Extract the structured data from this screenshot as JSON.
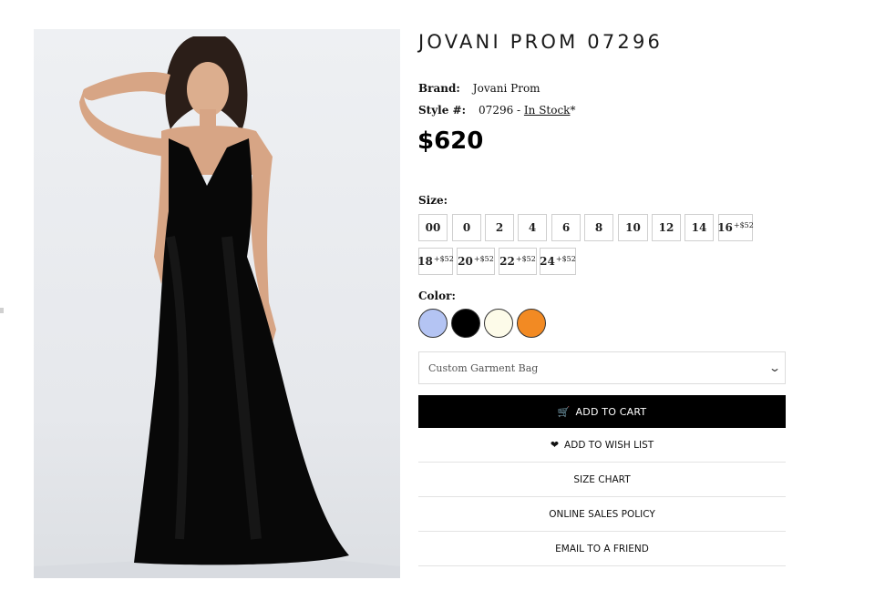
{
  "product": {
    "title": "JOVANI PROM 07296",
    "brand_label": "Brand:",
    "brand": "Jovani Prom",
    "style_label": "Style #:",
    "style_number": "07296 - ",
    "stock_status": "In Stock",
    "stock_asterisk": "*",
    "price": "$620",
    "image_alt": "Model wearing black lace-paneled gown"
  },
  "sizes": {
    "label": "Size:",
    "options": [
      {
        "size": "00",
        "surcharge": ""
      },
      {
        "size": "0",
        "surcharge": ""
      },
      {
        "size": "2",
        "surcharge": ""
      },
      {
        "size": "4",
        "surcharge": ""
      },
      {
        "size": "6",
        "surcharge": ""
      },
      {
        "size": "8",
        "surcharge": ""
      },
      {
        "size": "10",
        "surcharge": ""
      },
      {
        "size": "12",
        "surcharge": ""
      },
      {
        "size": "14",
        "surcharge": ""
      },
      {
        "size": "16",
        "surcharge": "+$52"
      },
      {
        "size": "18",
        "surcharge": "+$52"
      },
      {
        "size": "20",
        "surcharge": "+$52"
      },
      {
        "size": "22",
        "surcharge": "+$52"
      },
      {
        "size": "24",
        "surcharge": "+$52"
      }
    ]
  },
  "colors": {
    "label": "Color:",
    "swatches": [
      "#b4c4f3",
      "#000000",
      "#fdfbe9",
      "#f28a23"
    ]
  },
  "garment_bag": {
    "selected": "Custom Garment Bag"
  },
  "actions": {
    "add_to_cart": "ADD TO CART",
    "add_to_wishlist": "ADD TO WISH LIST",
    "size_chart": "SIZE CHART",
    "sales_policy": "ONLINE SALES POLICY",
    "email_friend": "EMAIL TO A FRIEND"
  },
  "icons": {
    "cart": "cart-icon",
    "heart": "heart-icon",
    "chevron": "chevron-down-icon"
  }
}
